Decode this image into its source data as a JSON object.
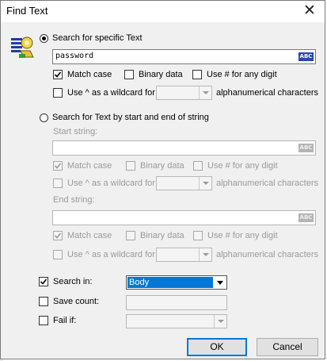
{
  "window": {
    "title": "Find Text",
    "close_glyph": "✕"
  },
  "specific": {
    "radio_label": "Search for specific Text",
    "search_value": "password",
    "abc_icon": "ABC",
    "match_case": "Match case",
    "binary_data": "Binary data",
    "use_hash": "Use # for any digit",
    "wildcard_prefix": "Use ^ as a wildcard for",
    "wildcard_suffix": "alphanumerical characters"
  },
  "range": {
    "radio_label": "Search for Text by start and end of string",
    "start_label": "Start string:",
    "end_label": "End string:",
    "start_value": "",
    "end_value": "",
    "abc_icon": "ABC",
    "match_case": "Match case",
    "binary_data": "Binary data",
    "use_hash": "Use # for any digit",
    "wildcard_prefix": "Use ^ as a wildcard for",
    "wildcard_suffix": "alphanumerical characters"
  },
  "options": {
    "search_in_label": "Search in:",
    "search_in_value": "Body",
    "save_count_label": "Save count:",
    "fail_if_label": "Fail if:"
  },
  "buttons": {
    "ok": "OK",
    "cancel": "Cancel"
  },
  "colors": {
    "selection": "#0078d7",
    "abc_badge": "#2b47a8"
  },
  "icons": [
    "dialog-binoculars-icon",
    "close-icon",
    "abc-icon",
    "check-icon",
    "dropdown-arrow-icon"
  ]
}
